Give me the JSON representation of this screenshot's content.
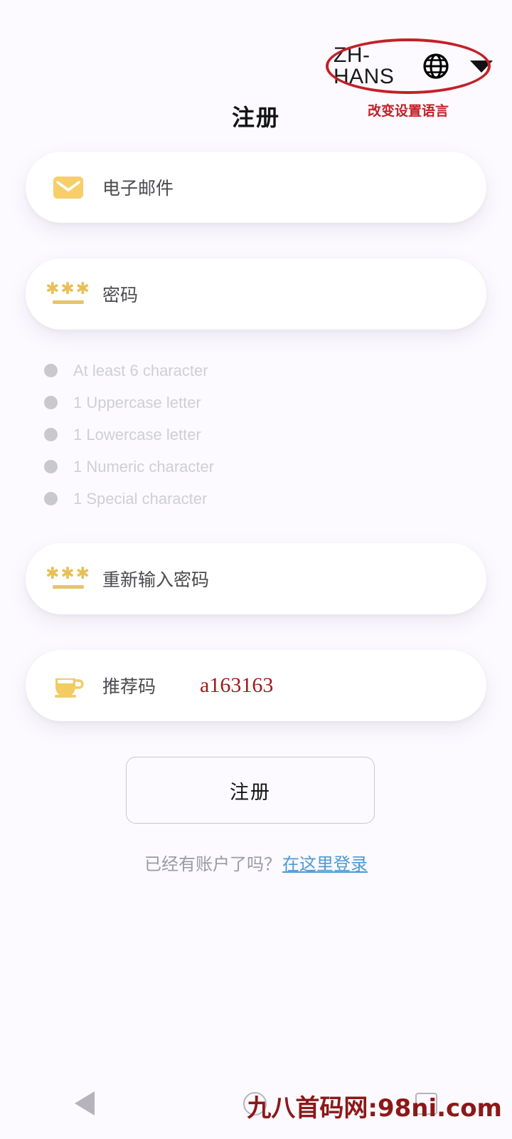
{
  "language_selector": {
    "code": "ZH-HANS",
    "globe_icon": "globe-icon",
    "caret_icon": "chevron-down-icon",
    "annotation": "改变设置语言"
  },
  "page_title": "注册",
  "fields": {
    "email": {
      "icon": "envelope-icon",
      "placeholder": "电子邮件",
      "value": ""
    },
    "password": {
      "icon": "password-asterisks-icon",
      "placeholder": "密码",
      "value": "",
      "stars": "✱✱✱"
    },
    "confirm_password": {
      "icon": "password-asterisks-icon",
      "placeholder": "重新输入密码",
      "value": "",
      "stars": "✱✱✱"
    },
    "referral": {
      "icon": "coffee-cup-icon",
      "placeholder": "推荐码",
      "value": "a163163"
    }
  },
  "password_requirements": [
    "At least 6 character",
    "1 Uppercase letter",
    "1 Lowercase letter",
    "1 Numeric character",
    "1 Special character"
  ],
  "register_button": "注册",
  "login_prompt": {
    "text": "已经有账户了吗？",
    "link": "在这里登录"
  },
  "navbar": {
    "back_icon": "back-triangle-icon",
    "home_icon": "home-circle-icon",
    "recent_icon": "recent-apps-square-icon"
  },
  "watermark": "九八首码网:98ni.com",
  "colors": {
    "background": "#fcfaff",
    "card": "#ffffff",
    "icon_gold": "#f0c75e",
    "annotation_red": "#c32027",
    "value_red": "#9e1b1b",
    "link_blue": "#4a9ad4",
    "requirement_gray": "#cfcfd3",
    "watermark_red": "#8c1818"
  }
}
